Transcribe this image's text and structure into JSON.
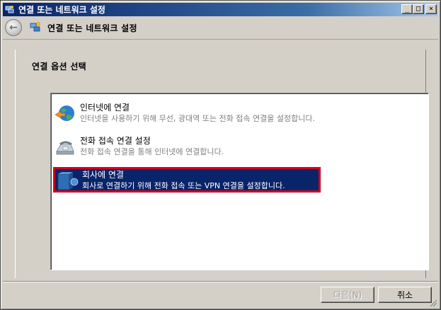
{
  "window": {
    "title": "연결 또는 네트워크 설정",
    "minimize_glyph": "_",
    "maximize_glyph": "□",
    "close_glyph": "×"
  },
  "nav": {
    "back_glyph": "←",
    "title": "연결 또는 네트워크 설정"
  },
  "main": {
    "heading": "연결 옵션 선택",
    "options": [
      {
        "name": "인터넷에 연결",
        "desc": "인터넷을 사용하기 위해 무선, 광대역 또는 전화 접속 연결을 설정합니다.",
        "icon": "globe-icon",
        "selected": false
      },
      {
        "name": "전화 접속 연결 설정",
        "desc": "전화 접속 연결을 통해 인터넷에 연결합니다.",
        "icon": "modem-phone-icon",
        "selected": false
      },
      {
        "name": "회사에 연결",
        "desc": "회사로 연결하기 위해 전화 접속 또는 VPN 연결을 설정합니다.",
        "icon": "workplace-icon",
        "selected": true
      }
    ]
  },
  "footer": {
    "next_label": "다음(N)",
    "cancel_label": "취소"
  },
  "colors": {
    "selection_bg": "#0a246a",
    "selection_border": "#d0021b",
    "titlebar_start": "#0a246a",
    "titlebar_end": "#a6caf0"
  }
}
